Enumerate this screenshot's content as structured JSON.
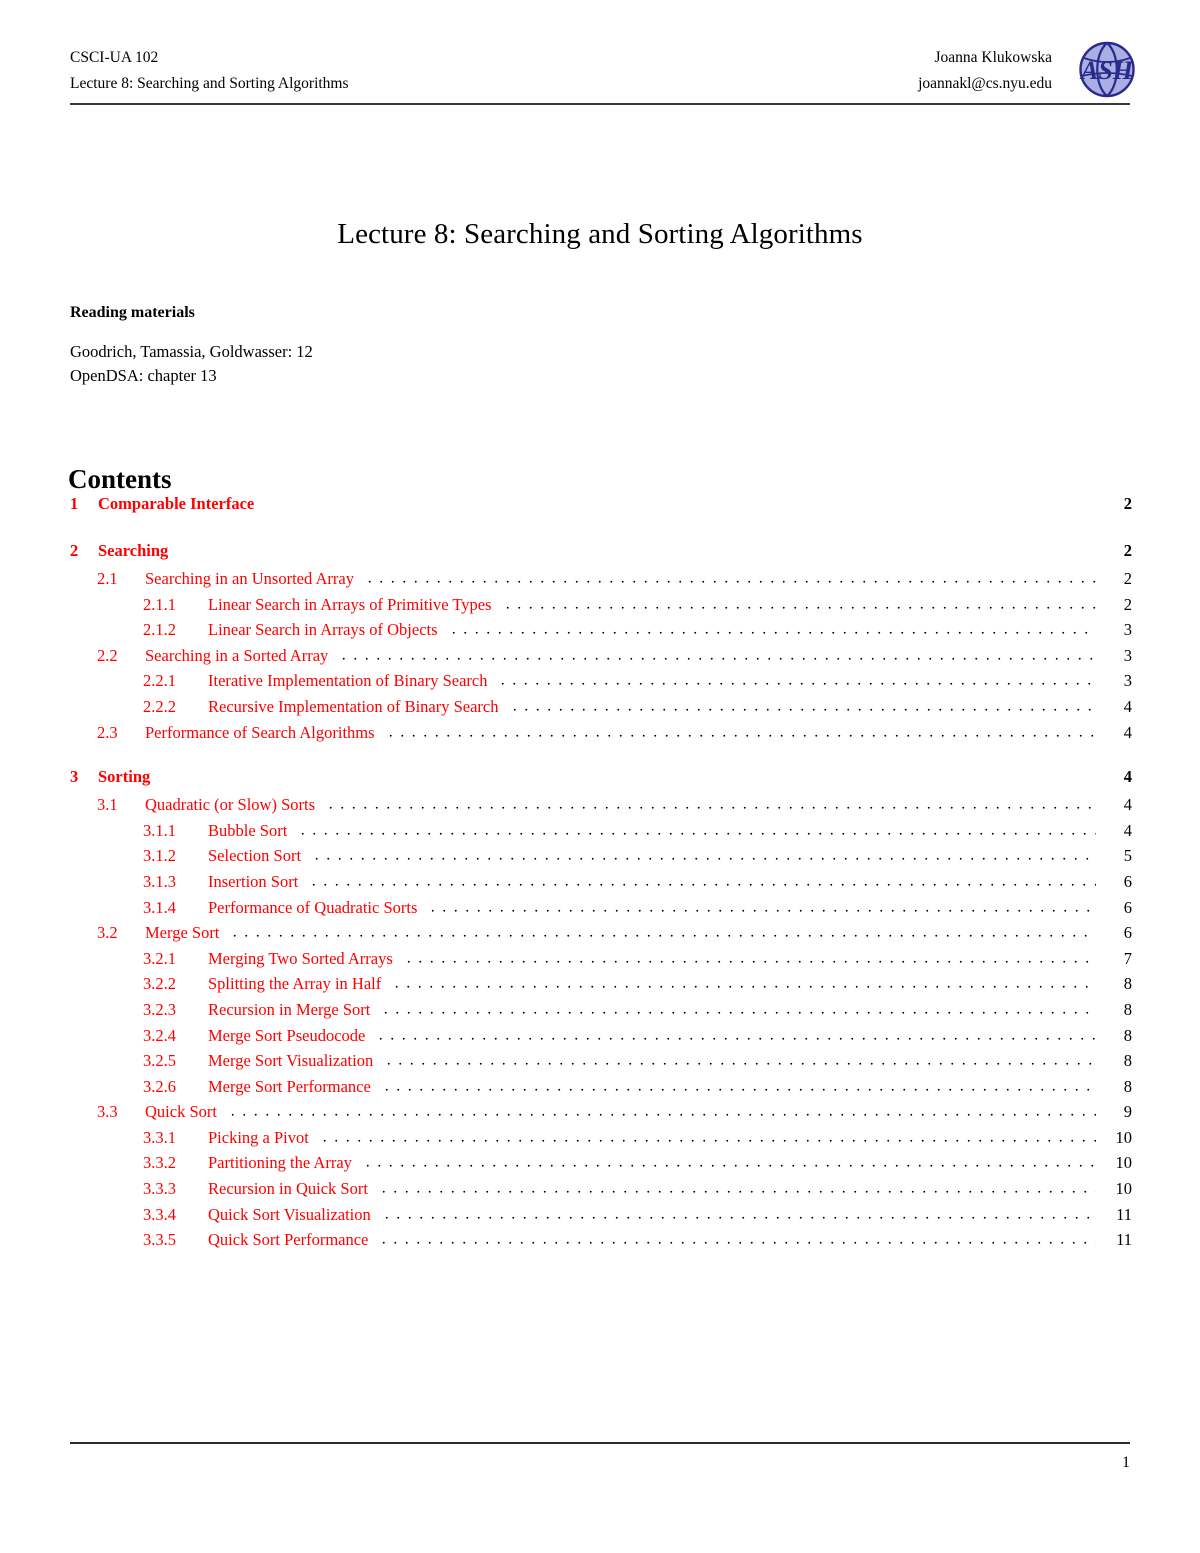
{
  "header": {
    "course_code": "CSCI-UA 102",
    "lecture_line": "Lecture 8: Searching and Sorting Algorithms",
    "author_name": "Joanna Klukowska",
    "author_email": "joannakl@cs.nyu.edu",
    "logo_text": "ASH",
    "logo_circle_color": "#a9afe2",
    "logo_ink_color": "#2a2a8c"
  },
  "title": "Lecture 8: Searching and Sorting Algorithms",
  "reading": {
    "heading": "Reading materials",
    "line1": "Goodrich, Tamassia, Goldwasser: 12",
    "line2": "OpenDSA: chapter 13"
  },
  "contents": {
    "heading": "Contents",
    "accent_color": "#ff0000",
    "entries": [
      {
        "level": 1,
        "number": "1",
        "label": "Comparable Interface",
        "page": "2",
        "gap_before": false
      },
      {
        "level": 1,
        "number": "2",
        "label": "Searching",
        "page": "2",
        "gap_before": true
      },
      {
        "level": 2,
        "number": "2.1",
        "label": "Searching in an Unsorted Array",
        "page": "2",
        "gap_before": false
      },
      {
        "level": 3,
        "number": "2.1.1",
        "label": "Linear Search in Arrays of Primitive Types",
        "page": "2",
        "gap_before": false
      },
      {
        "level": 3,
        "number": "2.1.2",
        "label": "Linear Search in Arrays of Objects",
        "page": "3",
        "gap_before": false
      },
      {
        "level": 2,
        "number": "2.2",
        "label": "Searching in a Sorted Array",
        "page": "3",
        "gap_before": false
      },
      {
        "level": 3,
        "number": "2.2.1",
        "label": "Iterative Implementation of Binary Search",
        "page": "3",
        "gap_before": false
      },
      {
        "level": 3,
        "number": "2.2.2",
        "label": "Recursive Implementation of Binary Search",
        "page": "4",
        "gap_before": false
      },
      {
        "level": 2,
        "number": "2.3",
        "label": "Performance of Search Algorithms",
        "page": "4",
        "gap_before": false
      },
      {
        "level": 1,
        "number": "3",
        "label": "Sorting",
        "page": "4",
        "gap_before": true
      },
      {
        "level": 2,
        "number": "3.1",
        "label": "Quadratic (or Slow) Sorts",
        "page": "4",
        "gap_before": false
      },
      {
        "level": 3,
        "number": "3.1.1",
        "label": "Bubble Sort",
        "page": "4",
        "gap_before": false
      },
      {
        "level": 3,
        "number": "3.1.2",
        "label": "Selection Sort",
        "page": "5",
        "gap_before": false
      },
      {
        "level": 3,
        "number": "3.1.3",
        "label": "Insertion Sort",
        "page": "6",
        "gap_before": false
      },
      {
        "level": 3,
        "number": "3.1.4",
        "label": "Performance of Quadratic Sorts",
        "page": "6",
        "gap_before": false
      },
      {
        "level": 2,
        "number": "3.2",
        "label": "Merge Sort",
        "page": "6",
        "gap_before": false
      },
      {
        "level": 3,
        "number": "3.2.1",
        "label": "Merging Two Sorted Arrays",
        "page": "7",
        "gap_before": false
      },
      {
        "level": 3,
        "number": "3.2.2",
        "label": "Splitting the Array in Half",
        "page": "8",
        "gap_before": false
      },
      {
        "level": 3,
        "number": "3.2.3",
        "label": "Recursion in Merge Sort",
        "page": "8",
        "gap_before": false
      },
      {
        "level": 3,
        "number": "3.2.4",
        "label": "Merge Sort Pseudocode",
        "page": "8",
        "gap_before": false
      },
      {
        "level": 3,
        "number": "3.2.5",
        "label": "Merge Sort Visualization",
        "page": "8",
        "gap_before": false
      },
      {
        "level": 3,
        "number": "3.2.6",
        "label": "Merge Sort Performance",
        "page": "8",
        "gap_before": false
      },
      {
        "level": 2,
        "number": "3.3",
        "label": "Quick Sort",
        "page": "9",
        "gap_before": false
      },
      {
        "level": 3,
        "number": "3.3.1",
        "label": "Picking a Pivot",
        "page": "10",
        "gap_before": false
      },
      {
        "level": 3,
        "number": "3.3.2",
        "label": "Partitioning the Array",
        "page": "10",
        "gap_before": false
      },
      {
        "level": 3,
        "number": "3.3.3",
        "label": "Recursion in Quick Sort",
        "page": "10",
        "gap_before": false
      },
      {
        "level": 3,
        "number": "3.3.4",
        "label": "Quick Sort Visualization",
        "page": "11",
        "gap_before": false
      },
      {
        "level": 3,
        "number": "3.3.5",
        "label": "Quick Sort Performance",
        "page": "11",
        "gap_before": false
      }
    ]
  },
  "footer": {
    "page_number": "1"
  }
}
